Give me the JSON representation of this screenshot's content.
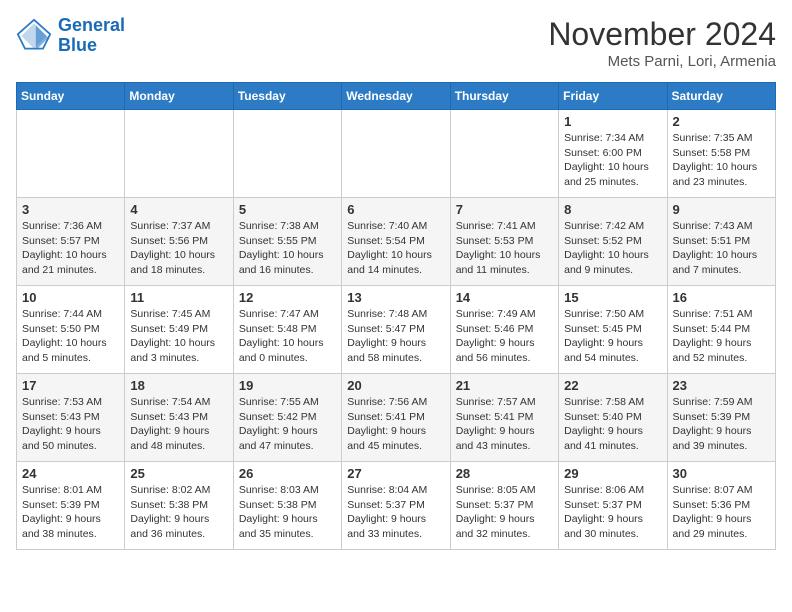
{
  "header": {
    "logo_line1": "General",
    "logo_line2": "Blue",
    "month": "November 2024",
    "location": "Mets Parni, Lori, Armenia"
  },
  "weekdays": [
    "Sunday",
    "Monday",
    "Tuesday",
    "Wednesday",
    "Thursday",
    "Friday",
    "Saturday"
  ],
  "weeks": [
    [
      {
        "day": "",
        "info": ""
      },
      {
        "day": "",
        "info": ""
      },
      {
        "day": "",
        "info": ""
      },
      {
        "day": "",
        "info": ""
      },
      {
        "day": "",
        "info": ""
      },
      {
        "day": "1",
        "info": "Sunrise: 7:34 AM\nSunset: 6:00 PM\nDaylight: 10 hours\nand 25 minutes."
      },
      {
        "day": "2",
        "info": "Sunrise: 7:35 AM\nSunset: 5:58 PM\nDaylight: 10 hours\nand 23 minutes."
      }
    ],
    [
      {
        "day": "3",
        "info": "Sunrise: 7:36 AM\nSunset: 5:57 PM\nDaylight: 10 hours\nand 21 minutes."
      },
      {
        "day": "4",
        "info": "Sunrise: 7:37 AM\nSunset: 5:56 PM\nDaylight: 10 hours\nand 18 minutes."
      },
      {
        "day": "5",
        "info": "Sunrise: 7:38 AM\nSunset: 5:55 PM\nDaylight: 10 hours\nand 16 minutes."
      },
      {
        "day": "6",
        "info": "Sunrise: 7:40 AM\nSunset: 5:54 PM\nDaylight: 10 hours\nand 14 minutes."
      },
      {
        "day": "7",
        "info": "Sunrise: 7:41 AM\nSunset: 5:53 PM\nDaylight: 10 hours\nand 11 minutes."
      },
      {
        "day": "8",
        "info": "Sunrise: 7:42 AM\nSunset: 5:52 PM\nDaylight: 10 hours\nand 9 minutes."
      },
      {
        "day": "9",
        "info": "Sunrise: 7:43 AM\nSunset: 5:51 PM\nDaylight: 10 hours\nand 7 minutes."
      }
    ],
    [
      {
        "day": "10",
        "info": "Sunrise: 7:44 AM\nSunset: 5:50 PM\nDaylight: 10 hours\nand 5 minutes."
      },
      {
        "day": "11",
        "info": "Sunrise: 7:45 AM\nSunset: 5:49 PM\nDaylight: 10 hours\nand 3 minutes."
      },
      {
        "day": "12",
        "info": "Sunrise: 7:47 AM\nSunset: 5:48 PM\nDaylight: 10 hours\nand 0 minutes."
      },
      {
        "day": "13",
        "info": "Sunrise: 7:48 AM\nSunset: 5:47 PM\nDaylight: 9 hours\nand 58 minutes."
      },
      {
        "day": "14",
        "info": "Sunrise: 7:49 AM\nSunset: 5:46 PM\nDaylight: 9 hours\nand 56 minutes."
      },
      {
        "day": "15",
        "info": "Sunrise: 7:50 AM\nSunset: 5:45 PM\nDaylight: 9 hours\nand 54 minutes."
      },
      {
        "day": "16",
        "info": "Sunrise: 7:51 AM\nSunset: 5:44 PM\nDaylight: 9 hours\nand 52 minutes."
      }
    ],
    [
      {
        "day": "17",
        "info": "Sunrise: 7:53 AM\nSunset: 5:43 PM\nDaylight: 9 hours\nand 50 minutes."
      },
      {
        "day": "18",
        "info": "Sunrise: 7:54 AM\nSunset: 5:43 PM\nDaylight: 9 hours\nand 48 minutes."
      },
      {
        "day": "19",
        "info": "Sunrise: 7:55 AM\nSunset: 5:42 PM\nDaylight: 9 hours\nand 47 minutes."
      },
      {
        "day": "20",
        "info": "Sunrise: 7:56 AM\nSunset: 5:41 PM\nDaylight: 9 hours\nand 45 minutes."
      },
      {
        "day": "21",
        "info": "Sunrise: 7:57 AM\nSunset: 5:41 PM\nDaylight: 9 hours\nand 43 minutes."
      },
      {
        "day": "22",
        "info": "Sunrise: 7:58 AM\nSunset: 5:40 PM\nDaylight: 9 hours\nand 41 minutes."
      },
      {
        "day": "23",
        "info": "Sunrise: 7:59 AM\nSunset: 5:39 PM\nDaylight: 9 hours\nand 39 minutes."
      }
    ],
    [
      {
        "day": "24",
        "info": "Sunrise: 8:01 AM\nSunset: 5:39 PM\nDaylight: 9 hours\nand 38 minutes."
      },
      {
        "day": "25",
        "info": "Sunrise: 8:02 AM\nSunset: 5:38 PM\nDaylight: 9 hours\nand 36 minutes."
      },
      {
        "day": "26",
        "info": "Sunrise: 8:03 AM\nSunset: 5:38 PM\nDaylight: 9 hours\nand 35 minutes."
      },
      {
        "day": "27",
        "info": "Sunrise: 8:04 AM\nSunset: 5:37 PM\nDaylight: 9 hours\nand 33 minutes."
      },
      {
        "day": "28",
        "info": "Sunrise: 8:05 AM\nSunset: 5:37 PM\nDaylight: 9 hours\nand 32 minutes."
      },
      {
        "day": "29",
        "info": "Sunrise: 8:06 AM\nSunset: 5:37 PM\nDaylight: 9 hours\nand 30 minutes."
      },
      {
        "day": "30",
        "info": "Sunrise: 8:07 AM\nSunset: 5:36 PM\nDaylight: 9 hours\nand 29 minutes."
      }
    ]
  ]
}
